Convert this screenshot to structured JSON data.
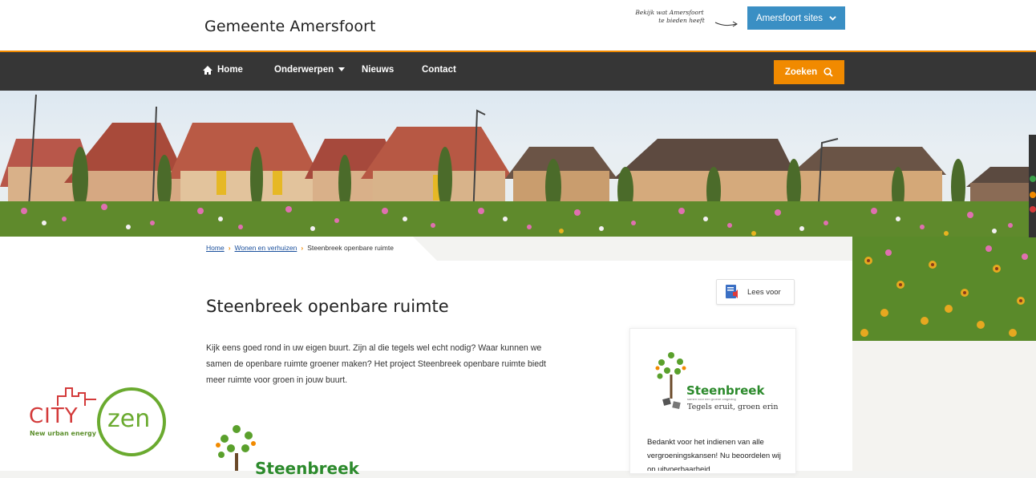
{
  "header": {
    "logo": "Gemeente Amersfoort",
    "handnote_line1": "Bekijk wat Amersfoort",
    "handnote_line2": "te bieden heeft",
    "sites_button": "Amersfoort sites"
  },
  "nav": {
    "items": [
      {
        "label": "Home"
      },
      {
        "label": "Onderwerpen"
      },
      {
        "label": "Nieuws"
      },
      {
        "label": "Contact"
      }
    ],
    "search_label": "Zoeken"
  },
  "breadcrumb": {
    "items": [
      "Home",
      "Wonen en verhuizen",
      "Steenbreek openbare ruimte"
    ]
  },
  "main": {
    "title": "Steenbreek openbare ruimte",
    "intro": "Kijk eens goed rond in uw eigen buurt. Zijn al die tegels wel echt nodig? Waar kunnen we samen de openbare ruimte groener maken? Het project Steenbreek openbare ruimte biedt meer ruimte voor groen in jouw buurt.",
    "read_aloud": "Lees voor",
    "logo_text": "Steenbreek"
  },
  "sidecard": {
    "logo_title": "Steenbreek",
    "logo_small": "samen voor een groene omgeving",
    "tagline": "Tegels eruit, groen erin",
    "text": "Bedankt voor het indienen van alle vergroeningskansen! Nu beoordelen wij op uitvoerbaarheid"
  },
  "cityzen": {
    "city": "CITY",
    "zen": "zen",
    "subtitle": "New urban energy"
  },
  "colors": {
    "accent_orange": "#f18a00",
    "nav_dark": "#363636",
    "sites_blue": "#3a8fc4",
    "link_blue": "#1a4f9c",
    "steenbreek_green": "#2c8a2c"
  }
}
